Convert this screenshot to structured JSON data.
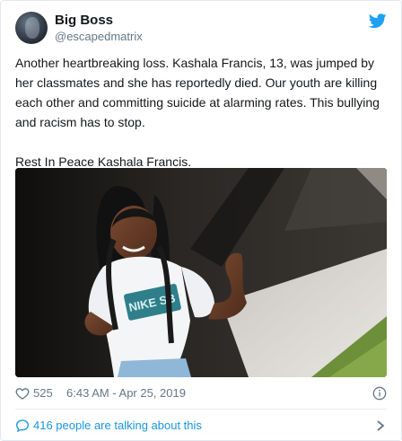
{
  "tweet": {
    "display_name": "Big Boss",
    "handle": "@escapedmatrix",
    "text": "Another heartbreaking loss. Kashala Francis, 13, was jumped by her classmates and she has reportedly died. Our youth are killing each other and committing suicide at alarming rates. This bullying and racism has to stop.\n\nRest In Peace Kashala Francis.",
    "likes": "525",
    "timestamp": "6:43 AM - Apr 25, 2019",
    "talking": "416 people are talking about this"
  },
  "photo": {
    "shirt_brand": "NIKE SB"
  },
  "colors": {
    "brand_blue": "#1da1f2",
    "link_blue": "#1b95e0",
    "muted": "#657786"
  },
  "icons": {
    "brand": "twitter-bird-icon",
    "like": "heart-icon",
    "info": "info-icon",
    "talk": "speech-bubble-icon",
    "more": "chevron-right-icon"
  }
}
